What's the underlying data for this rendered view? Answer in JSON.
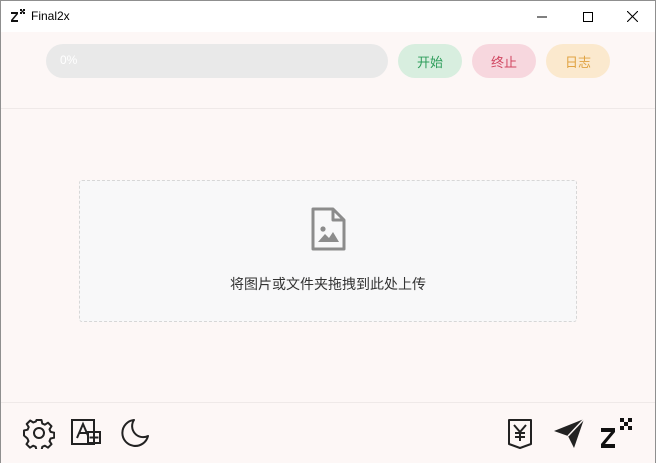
{
  "window": {
    "title": "Final2x",
    "controls": [
      "minimize-icon",
      "maximize-icon",
      "close-icon"
    ]
  },
  "toolbar": {
    "progress_label": "0%",
    "progress_value": 0,
    "start_label": "开始",
    "stop_label": "终止",
    "log_label": "日志"
  },
  "dropzone": {
    "icon": "image-file-icon",
    "text": "将图片或文件夹拖拽到此处上传"
  },
  "footer": {
    "left_icons": [
      "gear-icon",
      "translate-icon",
      "moon-icon"
    ],
    "right_icons": [
      "yen-icon",
      "send-icon",
      "final2x-logo-icon"
    ]
  },
  "colors": {
    "start_bg": "#d8eedf",
    "start_text": "#2e9d5b",
    "stop_bg": "#f7d7de",
    "stop_text": "#d04560",
    "log_bg": "#fbe9ce",
    "log_text": "#e0a343",
    "background": "#fdf7f6"
  }
}
